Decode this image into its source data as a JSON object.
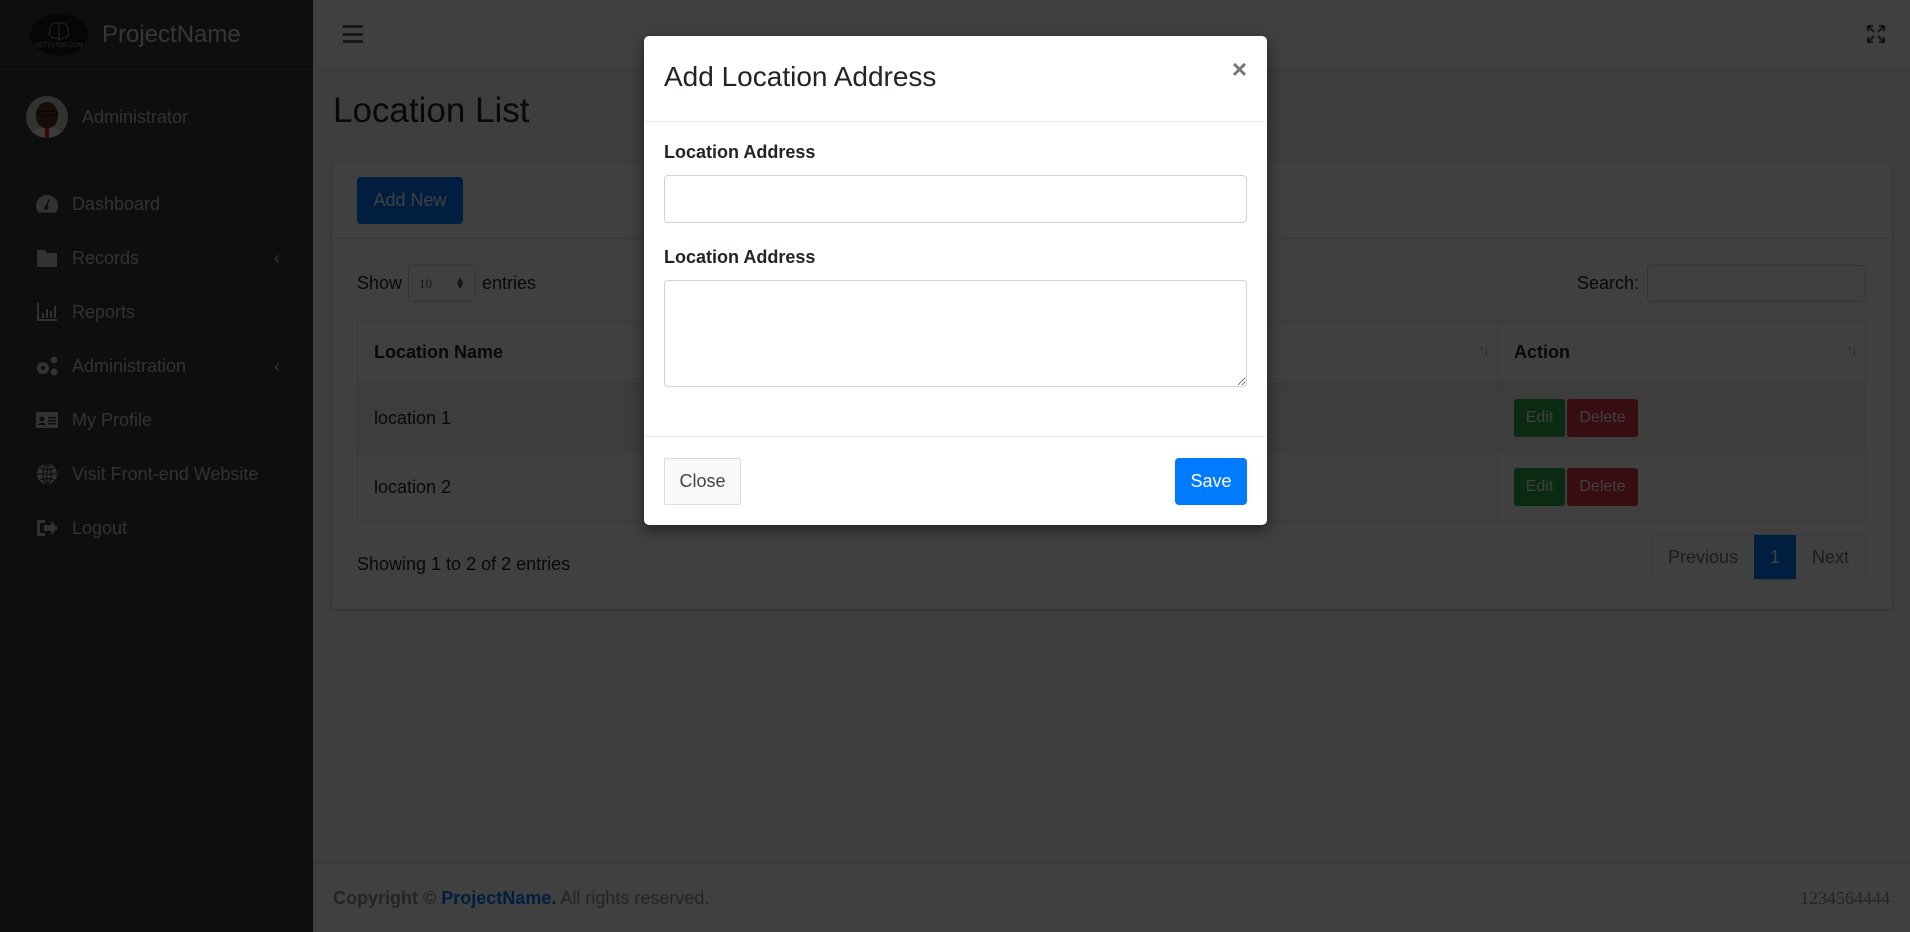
{
  "brand": {
    "name": "ProjectName",
    "logo_text": "NETTUTOR.COM"
  },
  "user": {
    "name": "Administrator"
  },
  "sidebar": {
    "items": [
      {
        "label": "Dashboard",
        "icon": "tachometer-icon",
        "has_submenu": false
      },
      {
        "label": "Records",
        "icon": "folder-icon",
        "has_submenu": true
      },
      {
        "label": "Reports",
        "icon": "chart-bar-icon",
        "has_submenu": false
      },
      {
        "label": "Administration",
        "icon": "cogs-icon",
        "has_submenu": true
      },
      {
        "label": "My Profile",
        "icon": "id-card-icon",
        "has_submenu": false
      },
      {
        "label": "Visit Front-end Website",
        "icon": "globe-icon",
        "has_submenu": false
      },
      {
        "label": "Logout",
        "icon": "sign-out-icon",
        "has_submenu": false
      }
    ]
  },
  "page": {
    "title": "Location List",
    "add_button": "Add New",
    "show_label": "Show",
    "entries_label": "entries",
    "page_length": "10",
    "search_label": "Search:",
    "search_value": "",
    "table": {
      "columns": [
        "Location Name",
        "",
        "Action"
      ],
      "rows": [
        {
          "name": "location 1",
          "actions": [
            "Edit",
            "Delete"
          ]
        },
        {
          "name": "location 2",
          "actions": [
            "Edit",
            "Delete"
          ]
        }
      ]
    },
    "info": "Showing 1 to 2 of 2 entries",
    "pagination": {
      "previous": "Previous",
      "current": "1",
      "next": "Next"
    }
  },
  "footer": {
    "copyright_prefix": "Copyright ©",
    "brand": "ProjectName.",
    "suffix": "All rights reserved.",
    "right_text": "1234564444"
  },
  "modal": {
    "title": "Add Location Address",
    "close_glyph": "×",
    "fields": [
      {
        "label": "Location Address",
        "value": "",
        "type": "input"
      },
      {
        "label": "Location Address",
        "value": "",
        "type": "textarea"
      }
    ],
    "close_button": "Close",
    "save_button": "Save"
  }
}
